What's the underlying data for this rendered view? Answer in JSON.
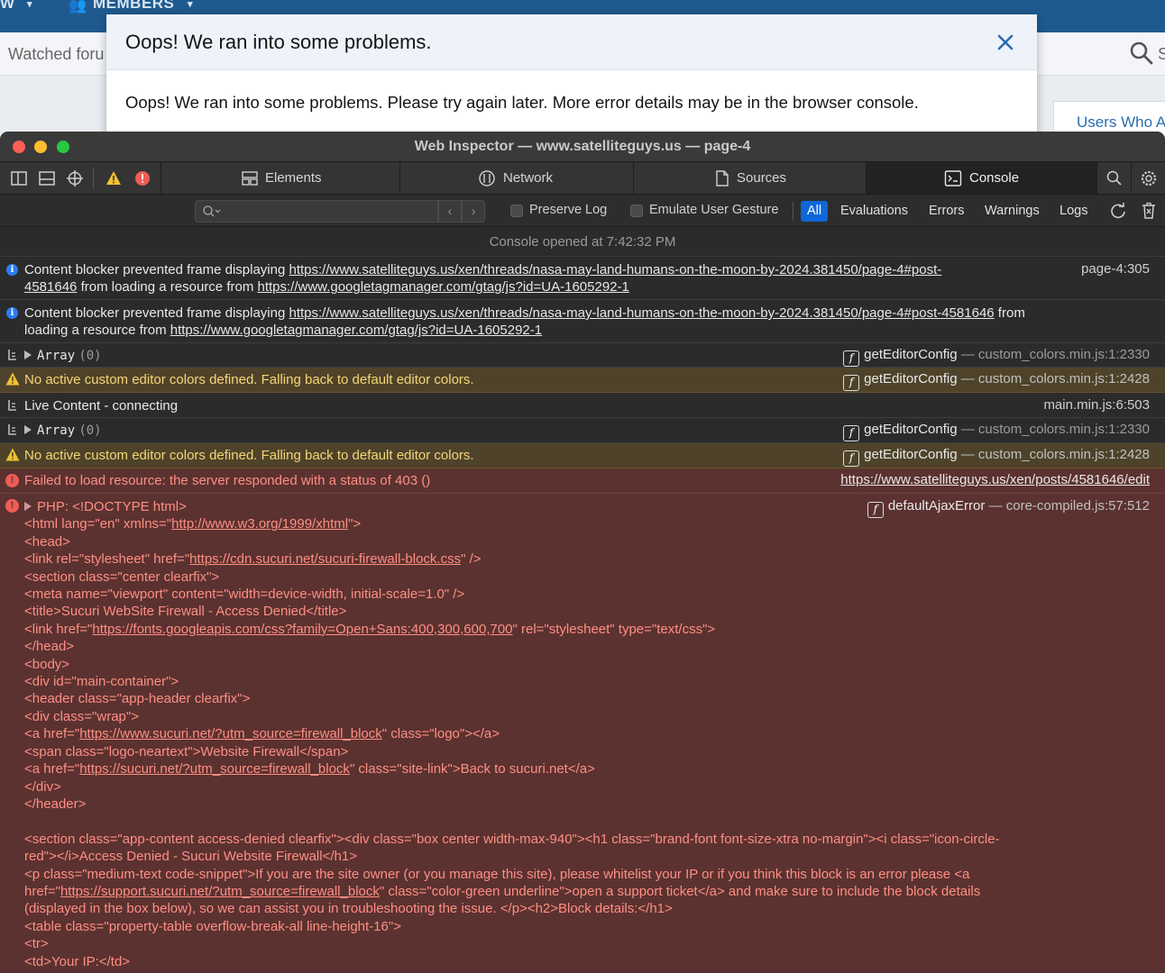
{
  "forum": {
    "nav_items": [
      "W",
      "MEMBERS"
    ],
    "subnav_text": "Watched foru",
    "search_stub": "S",
    "users_who": "Users Who Ar"
  },
  "modal": {
    "title": "Oops! We ran into some problems.",
    "body": "Oops! We ran into some problems. Please try again later. More error details may be in the browser console."
  },
  "inspector": {
    "window_title": "Web Inspector — www.satelliteguys.us — page-4",
    "tabs": [
      {
        "label": "Elements",
        "icon": "elements-icon"
      },
      {
        "label": "Network",
        "icon": "network-icon"
      },
      {
        "label": "Sources",
        "icon": "sources-icon"
      },
      {
        "label": "Console",
        "icon": "console-icon",
        "active": true
      }
    ],
    "filter": {
      "preserve_log": "Preserve Log",
      "emulate_gesture": "Emulate User Gesture",
      "levels": [
        "All",
        "Evaluations",
        "Errors",
        "Warnings",
        "Logs"
      ],
      "nav_prev": "‹",
      "nav_next": "›"
    },
    "console_opened": "Console opened at 7:42:32 PM",
    "messages": {
      "m1_text": "Content blocker prevented frame displaying ",
      "m1_link": "https://www.satelliteguys.us/xen/threads/nasa-may-land-humans-on-the-moon-by-2024.381450/page-4#post-",
      "m1_link2": "4581646",
      "m1_mid": " from loading a resource from ",
      "m1_link3": "https://www.googletagmanager.com/gtag/js?id=UA-1605292-1",
      "m1_loc": "page-4:305",
      "m2_text": "Content blocker prevented frame displaying ",
      "m2_link": "https://www.satelliteguys.us/xen/threads/nasa-may-land-humans-on-the-moon-by-2024.381450/page-4#post-4581646",
      "m2_mid": " from",
      "m2_mid2": "loading a resource from ",
      "m2_link2": "https://www.googletagmanager.com/gtag/js?id=UA-1605292-1",
      "array_label": "Array",
      "array_count": "(0)",
      "fn_get": "getEditorConfig",
      "sep": " — ",
      "loc_2330": "custom_colors.min.js:1:2330",
      "loc_2428": "custom_colors.min.js:1:2428",
      "warn_text": "No active custom editor colors defined. Falling back to default editor colors.",
      "live_text": "Live Content - connecting",
      "live_loc": "main.min.js:6:503",
      "fail_text": "Failed to load resource: the server responded with a status of 403 ()",
      "fail_loc": "https://www.satelliteguys.us/xen/posts/4581646/edit",
      "php_head": "PHP: <!DOCTYPE html>",
      "fn_ajax": "defaultAjaxError",
      "ajax_loc": "core-compiled.js:57:512"
    },
    "html_dump": {
      "l1a": "<html lang=\"en\" xmlns=\"",
      "l1link": "http://www.w3.org/1999/xhtml",
      "l1b": "\">",
      "l2": "<head>",
      "l3a": "<link rel=\"stylesheet\" href=\"",
      "l3link": "https://cdn.sucuri.net/sucuri-firewall-block.css",
      "l3b": "\" />",
      "l4": "<section class=\"center clearfix\">",
      "l5": "<meta name=\"viewport\" content=\"width=device-width, initial-scale=1.0\" />",
      "l6": "<title>Sucuri WebSite Firewall - Access Denied</title>",
      "l7a": "<link href=\"",
      "l7link": "https://fonts.googleapis.com/css?family=Open+Sans:400,300,600,700",
      "l7b": "\" rel=\"stylesheet\" type=\"text/css\">",
      "l8": "</head>",
      "l9": "<body>",
      "l10": "<div id=\"main-container\">",
      "l11": "<header class=\"app-header clearfix\">",
      "l12": "<div class=\"wrap\">",
      "l13a": "<a href=\"",
      "l13link": "https://www.sucuri.net/?utm_source=firewall_block",
      "l13b": "\" class=\"logo\"></a>",
      "l14": "<span class=\"logo-neartext\">Website Firewall</span>",
      "l15a": "<a href=\"",
      "l15link": "https://sucuri.net/?utm_source=firewall_block",
      "l15b": "\" class=\"site-link\">Back to sucuri.net</a>",
      "l16": "</div>",
      "l17": "</header>",
      "l18": "<section class=\"app-content access-denied clearfix\"><div class=\"box center width-max-940\"><h1 class=\"brand-font font-size-xtra no-margin\"><i class=\"icon-circle-",
      "l19": "red\"></i>Access Denied - Sucuri Website Firewall</h1>",
      "l20": "<p class=\"medium-text code-snippet\">If you are the site owner (or you manage this site), please whitelist your IP or if you think this block is an error please <a",
      "l21a": "href=\"",
      "l21link": "https://support.sucuri.net/?utm_source=firewall_block",
      "l21b": "\" class=\"color-green underline\">open a support ticket</a> and make sure to include the block details",
      "l22": "(displayed in the box below), so we can assist you in troubleshooting the issue. </p><h2>Block details:</h1>",
      "l23": "<table class=\"property-table overflow-break-all line-height-16\">",
      "l24": "<tr>",
      "l25": "<td>Your IP:</td>"
    }
  },
  "colors": {
    "forum_nav": "#1f5a8f",
    "accent_blue": "#0f67d9",
    "warning_bg": "#4e432a",
    "error_bg": "#5b3230",
    "error_text": "#ff8e84"
  }
}
